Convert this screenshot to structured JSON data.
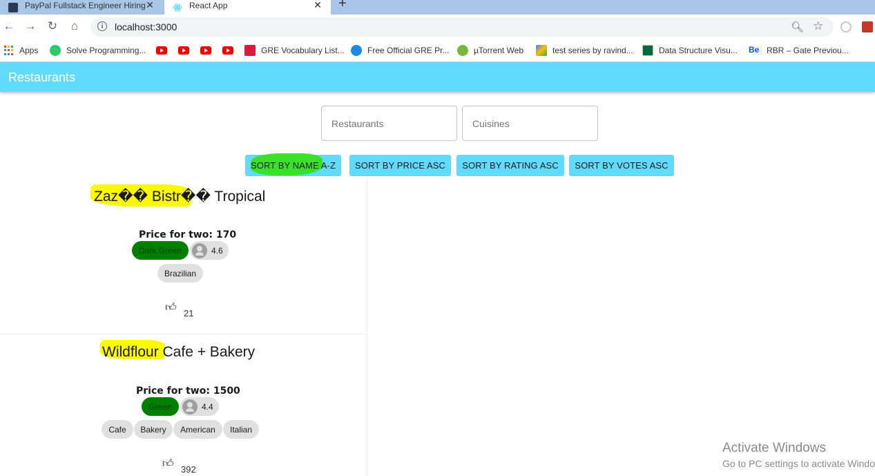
{
  "browser": {
    "tabs": [
      {
        "title": "PayPal Fullstack Engineer Hiring C",
        "close": "✕",
        "icon": "paypal-favicon"
      },
      {
        "title": "React App",
        "close": "✕",
        "icon": "react-favicon"
      }
    ],
    "new_tab": "+",
    "url": "localhost:3000",
    "bookmarks": [
      {
        "label": "Apps",
        "icon": "apps-grid-icon"
      },
      {
        "label": "Solve Programming...",
        "icon": "hackerrank-icon"
      },
      {
        "label": "",
        "icon": "youtube-icon"
      },
      {
        "label": "",
        "icon": "youtube-icon"
      },
      {
        "label": "",
        "icon": "youtube-icon"
      },
      {
        "label": "",
        "icon": "youtube-icon"
      },
      {
        "label": "GRE Vocabulary List...",
        "icon": "gre-icon"
      },
      {
        "label": "Free Official GRE Pr...",
        "icon": "ets-icon"
      },
      {
        "label": "µTorrent Web",
        "icon": "utorrent-icon"
      },
      {
        "label": "test series by ravind...",
        "icon": "test-series-icon"
      },
      {
        "label": "Data Structure Visu...",
        "icon": "usf-icon"
      },
      {
        "label": "RBR – Gate Previou...",
        "icon": "behance-icon"
      }
    ]
  },
  "app": {
    "title": "Restaurants",
    "search": {
      "restaurants_placeholder": "Restaurants",
      "cuisines_placeholder": "Cuisines"
    },
    "sort_buttons": [
      "SORT BY NAME A-Z",
      "SORT BY PRICE ASC",
      "SORT BY RATING ASC",
      "SORT BY VOTES ASC"
    ],
    "restaurants": [
      {
        "name": "Zaz�� Bistr�� Tropical",
        "price": "Price for two: 170",
        "rating_color": "Dark Green",
        "rating": "4.6",
        "cuisines": [
          "Brazilian"
        ],
        "votes": "21"
      },
      {
        "name": "Wildflour Cafe + Bakery",
        "price": "Price for two: 1500",
        "rating_color": "Green",
        "rating": "4.4",
        "cuisines": [
          "Cafe",
          "Bakery",
          "American",
          "Italian"
        ],
        "votes": "392"
      }
    ]
  },
  "watermark": {
    "line1": "Activate Windows",
    "line2": "Go to PC settings to activate Windows."
  },
  "colors": {
    "appbar": "#61dafb",
    "rating_green": "#008000",
    "highlight_yellow": "#f9f900",
    "highlight_green": "#39e01c"
  }
}
